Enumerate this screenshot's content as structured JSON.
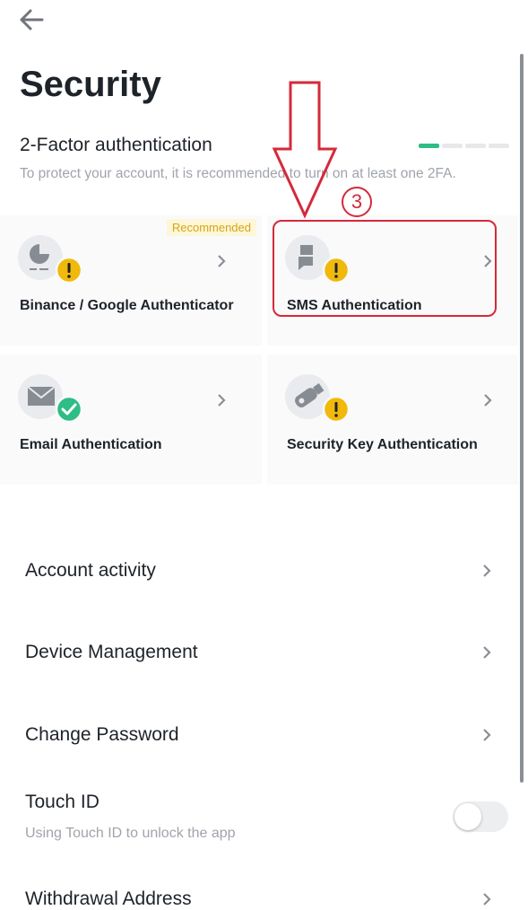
{
  "header": {
    "back_icon": "arrow-left-icon",
    "title": "Security"
  },
  "two_factor": {
    "heading": "2-Factor authentication",
    "description": "To protect your account, it is recommended to turn on at least one 2FA.",
    "progress": {
      "segments_total": 4,
      "segments_filled": 1,
      "fill_color": "#2ebd85"
    },
    "methods": [
      {
        "label": "Binance / Google Authenticator",
        "icon": "authenticator-icon",
        "status": "warning",
        "badge": "Recommended"
      },
      {
        "label": "SMS Authentication",
        "icon": "sms-icon",
        "status": "warning"
      },
      {
        "label": "Email Authentication",
        "icon": "email-icon",
        "status": "enabled"
      },
      {
        "label": "Security Key Authentication",
        "icon": "security-key-icon",
        "status": "warning"
      }
    ]
  },
  "settings": {
    "account_activity": "Account activity",
    "device_management": "Device Management",
    "change_password": "Change Password",
    "touch_id": {
      "label": "Touch ID",
      "sublabel": "Using Touch ID to unlock the app",
      "enabled": false
    },
    "withdrawal_address": "Withdrawal Address"
  },
  "annotation": {
    "step_number": "3",
    "color": "#d42a3a"
  },
  "colors": {
    "warning": "#f0b90b",
    "success": "#2ebd85",
    "text_primary": "#1e2329",
    "text_secondary": "#a0a4ab"
  }
}
